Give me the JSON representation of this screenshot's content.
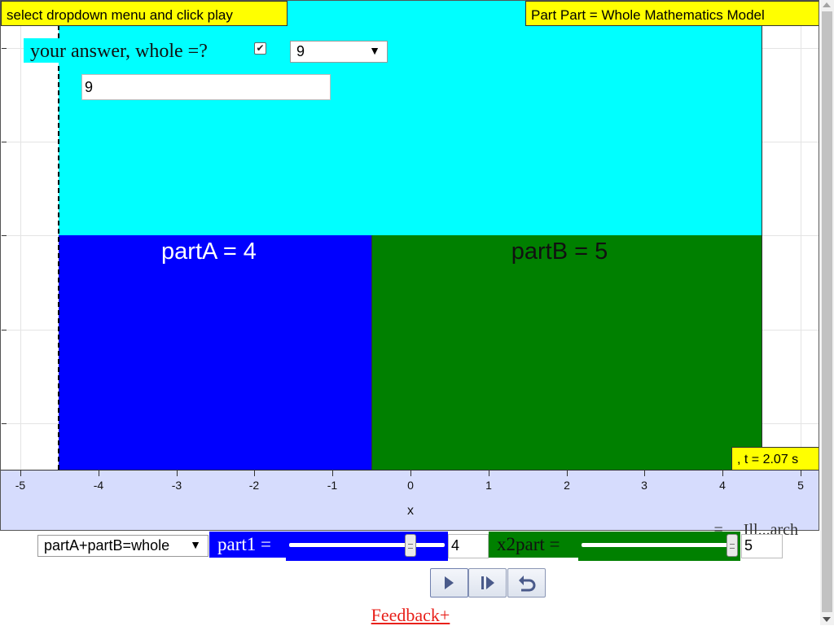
{
  "banner": {
    "instruction": "select dropdown menu and click play"
  },
  "header": {
    "title": "Part Part = Whole Mathematics Model"
  },
  "answer": {
    "label": "your answer, whole =?",
    "checkbox_checked": true,
    "checkbox_mark": "✔",
    "dropdown_selected": "9",
    "input_value": "9"
  },
  "model": {
    "partA_label": "partA = 4",
    "partB_label": "partB = 5",
    "colors": {
      "whole": "#00ffff",
      "partA": "#0000ff",
      "partB": "#008000",
      "highlight": "#ffff00",
      "axis_band": "#d6dcfd"
    }
  },
  "time_readout": ", t = 2.07 s",
  "axis": {
    "x_label": "x",
    "ticks": [
      "-5",
      "-4",
      "-3",
      "-2",
      "-1",
      "0",
      "1",
      "2",
      "3",
      "4",
      "5"
    ]
  },
  "controls": {
    "equation_dropdown": "partA+partB=whole",
    "part1_label": "part1 =",
    "part1_value": "4",
    "part1_slider_fraction": 0.8,
    "x2part_label": "x2part =",
    "x2part_value": "5",
    "x2part_slider_fraction": 1.0,
    "play_icon": "play-icon",
    "step_icon": "step-forward-icon",
    "reset_icon": "reset-icon"
  },
  "partially_hidden_text": "... = ... Ill...arch",
  "footer": {
    "feedback_label": "Feedback+"
  }
}
